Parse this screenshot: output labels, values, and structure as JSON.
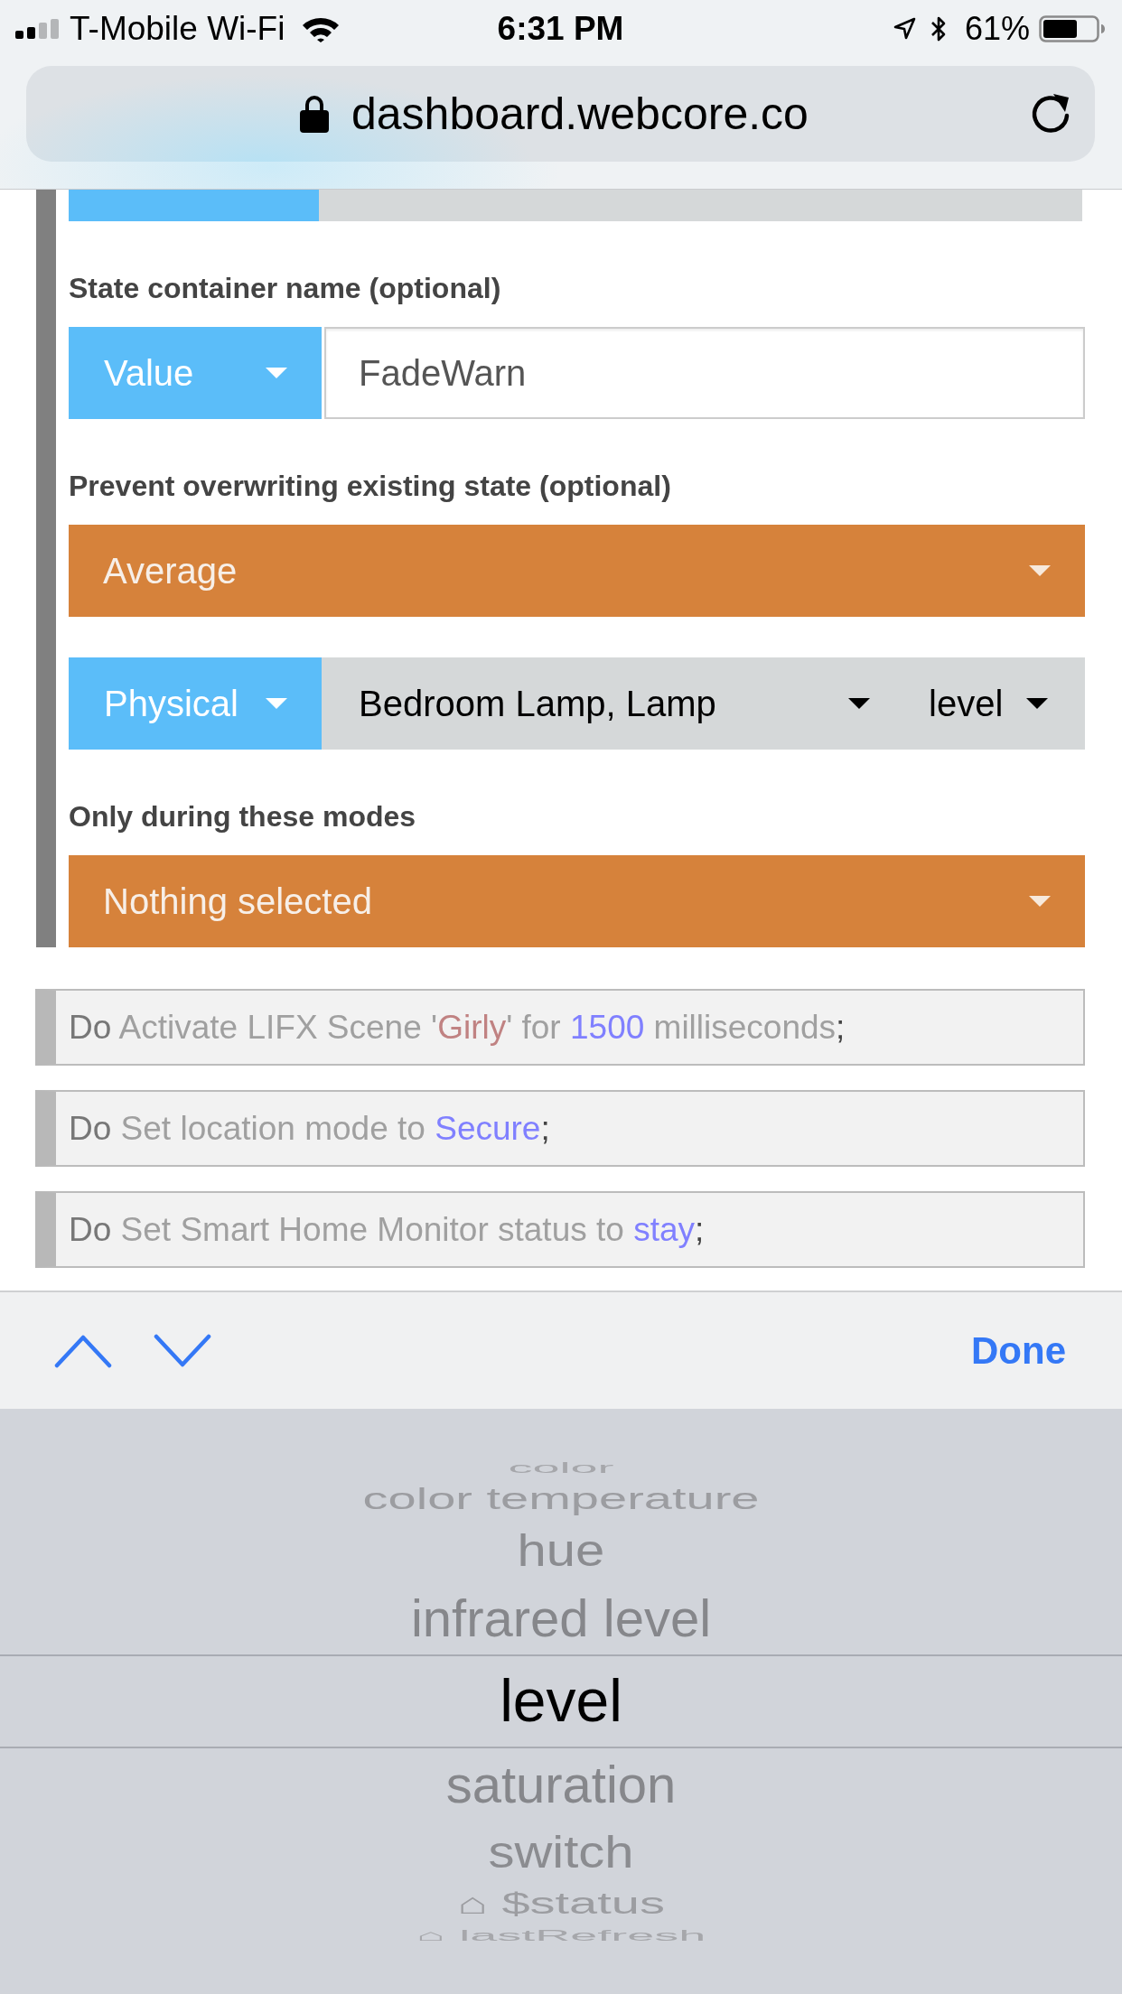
{
  "status_bar": {
    "carrier": "T-Mobile Wi-Fi",
    "time": "6:31 PM",
    "battery": "61%"
  },
  "address_bar": {
    "url": "dashboard.webcore.co"
  },
  "form": [
    {
      "label": "State container name (optional)",
      "control": {
        "kind": "typed_value",
        "type": "Value",
        "value": "FadeWarn"
      }
    },
    {
      "label": "Prevent overwriting existing state (optional)",
      "control": {
        "kind": "select",
        "value": "Average"
      }
    },
    {
      "control": {
        "kind": "device_attribute",
        "type": "Physical",
        "device": "Bedroom Lamp, Lamp",
        "attribute": "level"
      }
    },
    {
      "label": "Only during these modes",
      "control": {
        "kind": "select",
        "value": "Nothing selected"
      }
    }
  ],
  "statements": [
    {
      "parts": [
        {
          "kind": "keyword",
          "text": "Do"
        },
        {
          "kind": "plain",
          "text": " Activate LIFX Scene '"
        },
        {
          "kind": "string",
          "text": "Girly"
        },
        {
          "kind": "plain",
          "text": "' for "
        },
        {
          "kind": "number",
          "text": "1500"
        },
        {
          "kind": "plain",
          "text": " milliseconds"
        },
        {
          "kind": "punct",
          "text": ";"
        }
      ]
    },
    {
      "parts": [
        {
          "kind": "keyword",
          "text": "Do"
        },
        {
          "kind": "plain",
          "text": " Set location mode to "
        },
        {
          "kind": "value",
          "text": "Secure"
        },
        {
          "kind": "punct",
          "text": ";"
        }
      ]
    },
    {
      "parts": [
        {
          "kind": "keyword",
          "text": "Do"
        },
        {
          "kind": "plain",
          "text": " Set Smart Home Monitor status to "
        },
        {
          "kind": "value",
          "text": "stay"
        },
        {
          "kind": "punct",
          "text": ";"
        }
      ]
    }
  ],
  "keyboard_toolbar": {
    "done": "Done"
  },
  "picker": {
    "options": [
      {
        "label": "color",
        "selected": false
      },
      {
        "label": "color temperature",
        "selected": false
      },
      {
        "label": "hue",
        "selected": false
      },
      {
        "label": "infrared level",
        "selected": false
      },
      {
        "label": "level",
        "selected": true
      },
      {
        "label": "saturation",
        "selected": false
      },
      {
        "label": "switch",
        "selected": false
      },
      {
        "label": "⌂ $status",
        "selected": false
      },
      {
        "label": "⌂ lastRefresh",
        "selected": false
      }
    ]
  }
}
